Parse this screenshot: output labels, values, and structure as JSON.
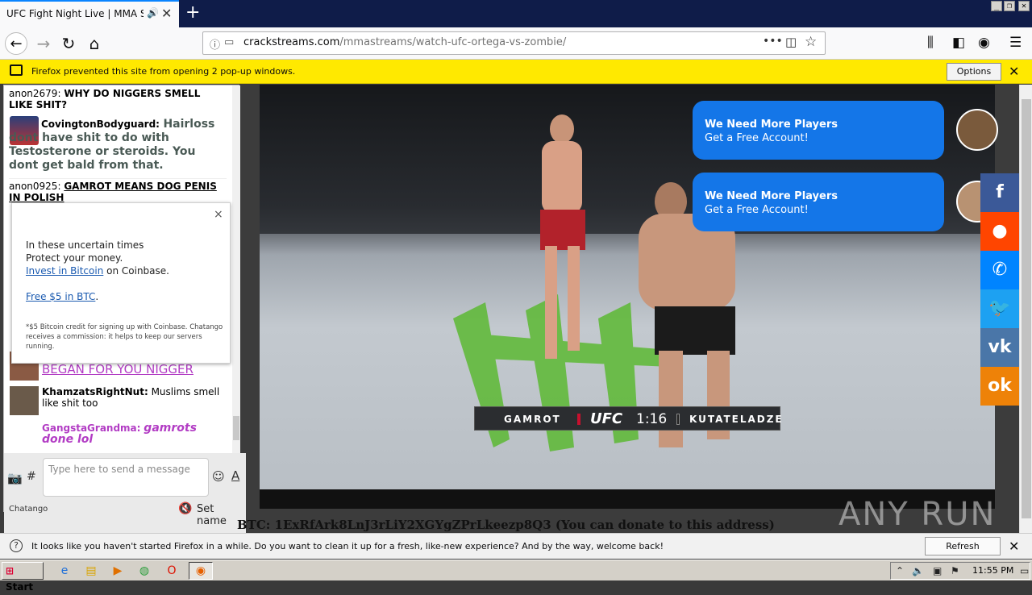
{
  "tab": {
    "title": "UFC Fight Night Live | MMA Stream",
    "audio_icon": "speaker-icon",
    "close": "✕"
  },
  "newtab": "+",
  "window_controls": {
    "minimize": "_",
    "restore": "❐",
    "close": "✕"
  },
  "url": {
    "host": "crackstreams.com",
    "path": "/mmastreams/watch-ufc-ortega-vs-zombie/",
    "more": "•••"
  },
  "popup_bar": {
    "text": "Firefox prevented this site from opening 2 pop-up windows.",
    "options": "Options",
    "close": "✕"
  },
  "chat": {
    "messages": [
      {
        "user": "anon2679:",
        "text": "WHY DO NIGGERS SMELL LIKE SHIT?"
      },
      {
        "user": "CovingtonBodyguard:",
        "text": "Hairloss dont have shit to do with Testosterone or steroids. You dont get bald from that."
      },
      {
        "user": "anon0925:",
        "text": "GAMROT MEANS DOG PENIS IN POLISH"
      },
      {
        "user": "",
        "text": "BEGAN FOR YOU NIGGER"
      },
      {
        "user": "KhamzatsRightNut:",
        "text": "Muslims smell like shit too"
      },
      {
        "user": "GangstaGrandma:",
        "text": "gamrots done lol"
      }
    ],
    "input_placeholder": "Type here to send a message",
    "hash": "#",
    "font_button": "A",
    "brand": "Chatango",
    "set_name": "Set name"
  },
  "coinbase_popup": {
    "close": "×",
    "line1": "In these uncertain times",
    "line2": "Protect your money.",
    "link1": "Invest in Bitcoin",
    "line3_suffix": " on Coinbase.",
    "link2": "Free $5 in BTC",
    "link2_suffix": ".",
    "fine_print": "*$5 Bitcoin credit for signing up with Coinbase. Chatango receives a commission: it helps to keep our servers running."
  },
  "scoreboard": {
    "fighter1": "GAMROT",
    "brand": "UFC",
    "time": "1:16",
    "fighter2": "KUTATELADZE"
  },
  "ads": [
    {
      "title": "We Need More Players",
      "subtitle": "Get a Free Account!"
    },
    {
      "title": "We Need More Players",
      "subtitle": "Get a Free Account!"
    }
  ],
  "share_buttons": [
    {
      "name": "facebook",
      "glyph": "f",
      "color": "#3b5998"
    },
    {
      "name": "reddit",
      "glyph": "●",
      "color": "#ff4500"
    },
    {
      "name": "messenger",
      "glyph": "✆",
      "color": "#0084ff"
    },
    {
      "name": "twitter",
      "glyph": "🐦",
      "color": "#1da1f2"
    },
    {
      "name": "vk",
      "glyph": "vk",
      "color": "#4a76a8"
    },
    {
      "name": "odnoklassniki",
      "glyph": "ok",
      "color": "#ee8208"
    }
  ],
  "btc_text": "BTC: 1ExRfArk8LnJ3rLiY2XGYgZPrLkeezp8Q3 (You can donate to this address)",
  "watermark": "ANY RUN",
  "notification": {
    "text": "It looks like you haven't started Firefox in a while. Do you want to clean it up for a fresh, like-new experience? And by the way, welcome back!",
    "button": "Refresh Firefox…",
    "close": "✕"
  },
  "taskbar": {
    "start": "Start",
    "clock": "11:55 PM"
  }
}
